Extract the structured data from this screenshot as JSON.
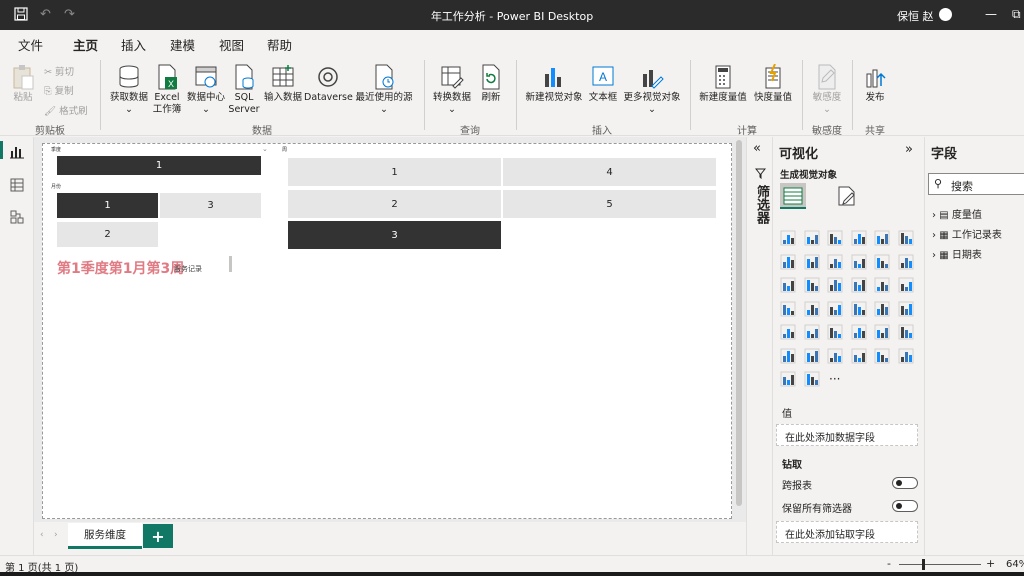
{
  "titlebar": {
    "title": "年工作分析 - Power BI Desktop",
    "user": "保恒 赵",
    "save_icon": "save-icon",
    "undo_icon": "undo-icon",
    "redo_icon": "redo-icon"
  },
  "menu": {
    "tabs": [
      "文件",
      "主页",
      "插入",
      "建模",
      "视图",
      "帮助"
    ],
    "active": "主页"
  },
  "ribbon": {
    "clipboard": {
      "paste": "粘贴",
      "cut": "剪切",
      "copy": "复制",
      "format_painter": "格式刷",
      "group": "剪贴板"
    },
    "data": {
      "get_data": "获取数据",
      "excel_1": "Excel",
      "excel_2": "工作簿",
      "data_hub": "数据中心",
      "sql_1": "SQL",
      "sql_2": "Server",
      "enter_data": "输入数据",
      "dataverse": "Dataverse",
      "recent_sources": "最近使用的源",
      "group": "数据"
    },
    "queries": {
      "transform": "转换数据",
      "refresh": "刷新",
      "group": "查询"
    },
    "insert": {
      "new_visual": "新建视觉对象",
      "text_box": "文本框",
      "more_visuals": "更多视觉对象",
      "group": "插入"
    },
    "calculations": {
      "new_measure": "新建度量值",
      "quick_measure": "快度量值",
      "group": "计算"
    },
    "sensitivity": {
      "label": "敏感度",
      "group": "敏感度"
    },
    "share": {
      "publish": "发布",
      "group": "共享"
    }
  },
  "canvas": {
    "quarter_slicer": {
      "header": "季度",
      "items": [
        "1"
      ],
      "selected": "1"
    },
    "month_slicer": {
      "header": "月份",
      "items": [
        "1",
        "3",
        "2"
      ],
      "selected": "1"
    },
    "week_slicer": {
      "header": "周",
      "items": [
        "1",
        "4",
        "2",
        "5",
        "3"
      ],
      "selected": "3"
    },
    "big_text": "第1季度第1月第3周",
    "small_text": "服务记录"
  },
  "pages": {
    "tabs": [
      "服务维度"
    ],
    "add_label": "+"
  },
  "filters": {
    "label": "筛选器"
  },
  "visualizations": {
    "title": "可视化",
    "build_visual": "生成视觉对象",
    "values_label": "值",
    "values_placeholder": "在此处添加数据字段",
    "drillthrough_label": "钻取",
    "cross_report": "跨报表",
    "keep_filters": "保留所有筛选器",
    "drill_placeholder": "在此处添加钻取字段",
    "more": "···"
  },
  "fields": {
    "title": "字段",
    "search_placeholder": "搜索",
    "tables": [
      "度量值",
      "工作记录表",
      "日期表"
    ]
  },
  "status": {
    "page_info": "第 1 页(共 1 页)",
    "zoom": "64%",
    "zoom_minus": "-",
    "zoom_plus": "+"
  },
  "colors": {
    "accent": "#117865",
    "selected_tile": "#333333",
    "title_text": "#e07b84"
  }
}
